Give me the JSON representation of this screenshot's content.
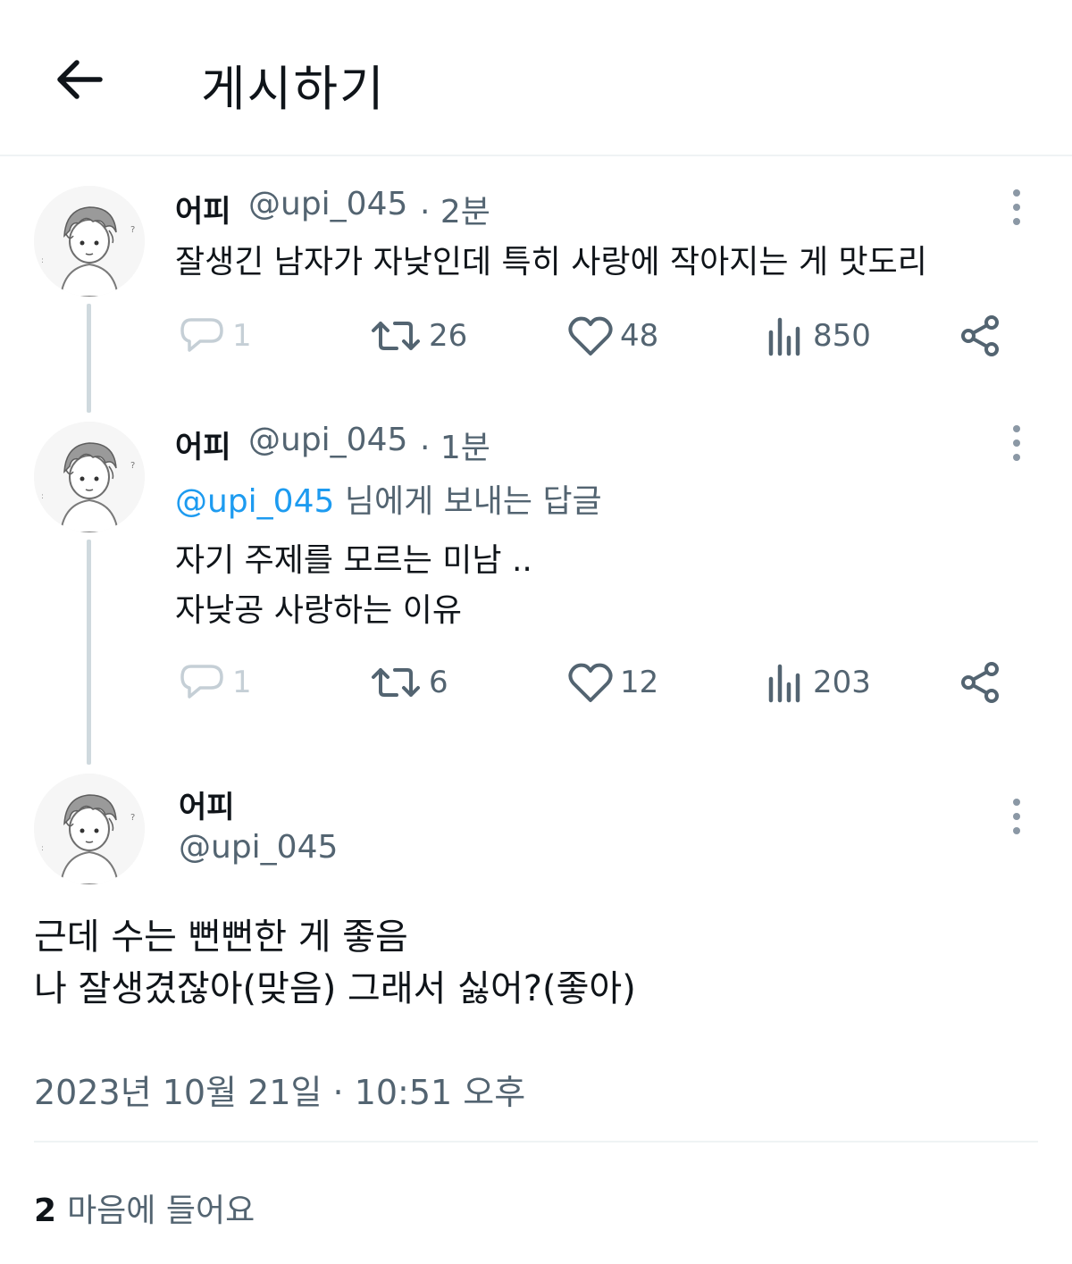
{
  "header": {
    "title": "게시하기"
  },
  "thread": [
    {
      "name": "어피",
      "handle": "@upi_045",
      "time": "· 2분",
      "text": "잘생긴 남자가 자낮인데 특히 사랑에 작아지는 게 맛도리",
      "stats": {
        "replies": "1",
        "retweets": "26",
        "likes": "48",
        "views": "850"
      }
    },
    {
      "name": "어피",
      "handle": "@upi_045",
      "time": "· 1분",
      "reply_mention": "@upi_045",
      "reply_suffix": " 님에게 보내는 답글",
      "lines": [
        "자기 주제를 모르는 미남 ..",
        "자낮공 사랑하는 이유"
      ],
      "stats": {
        "replies": "1",
        "retweets": "6",
        "likes": "12",
        "views": "203"
      }
    }
  ],
  "main_post": {
    "name": "어피",
    "handle": "@upi_045",
    "lines": [
      "근데 수는 뻔뻔한 게 좋음",
      "나 잘생겼잖아(맞음) 그래서 싫어?(좋아)"
    ],
    "timestamp": "2023년 10월 21일 · 10:51 오후",
    "likes_count": "2",
    "likes_label": "마음에 들어요"
  },
  "icons": {
    "back": "arrow-left-icon",
    "reply": "comment-bubble-icon",
    "retweet": "retweet-icon",
    "like": "heart-icon",
    "views": "bar-chart-icon",
    "share": "share-nodes-icon",
    "more": "vertical-dots-icon"
  },
  "colors": {
    "mention": "#1d9bf0",
    "secondary_text": "#536471",
    "thread_line": "#cfd9de"
  }
}
